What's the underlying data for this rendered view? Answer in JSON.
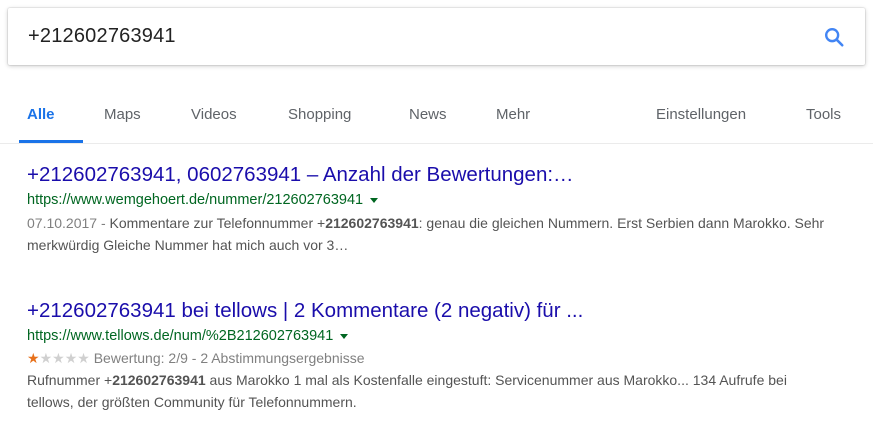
{
  "search": {
    "query": "+212602763941"
  },
  "tabs": {
    "all": "Alle",
    "maps": "Maps",
    "videos": "Videos",
    "shopping": "Shopping",
    "news": "News",
    "more": "Mehr",
    "settings": "Einstellungen",
    "tools": "Tools"
  },
  "colors": {
    "accent": "#1a73e8",
    "link": "#1a0dab",
    "url": "#006621",
    "star": "#e7711b"
  },
  "results": [
    {
      "title": "+212602763941, 0602763941 – Anzahl der Bewertungen:…",
      "url": "https://www.wemgehoert.de/nummer/212602763941",
      "date": "07.10.2017 - ",
      "snippet_pre": "Kommentare zur Telefonnummer +",
      "snippet_bold": "212602763941",
      "snippet_post": ": genau die gleichen Nummern. Erst Serbien dann Marokko. Sehr merkwürdig Gleiche Nummer hat mich auch vor 3…"
    },
    {
      "title": "+212602763941 bei tellows | 2 Kommentare (2 negativ) für ...",
      "url": "https://www.tellows.de/num/%2B212602763941",
      "rating_stars": 1,
      "rating_max": 5,
      "rating_text": "Bewertung: 2/9 - 2 Abstimmungsergebnisse",
      "snippet_pre": "Rufnummer +",
      "snippet_bold": "212602763941",
      "snippet_post": " aus Marokko 1 mal als Kostenfalle eingestuft: Servicenummer aus Marokko... 134 Aufrufe bei tellows, der größten Community für Telefonnummern."
    }
  ]
}
